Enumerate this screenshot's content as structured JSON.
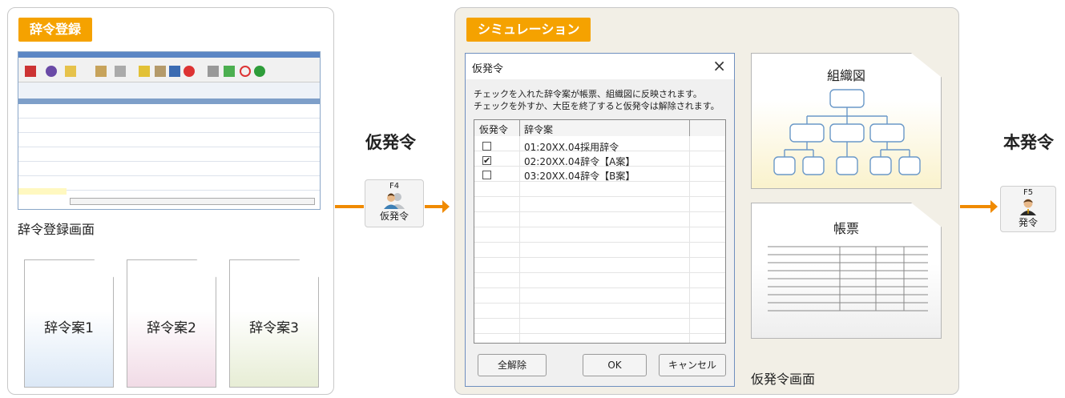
{
  "left": {
    "tag": "辞令登録",
    "screen_caption": "辞令登録画面",
    "drafts": [
      "辞令案1",
      "辞令案2",
      "辞令案3"
    ]
  },
  "middle": {
    "action_label": "仮発令",
    "fkey": {
      "key": "F4",
      "label": "仮発令"
    }
  },
  "simulation": {
    "tag": "シミュレーション",
    "dialog": {
      "title": "仮発令",
      "close": "×",
      "message_line1": "チェックを入れた辞令案が帳票、組織図に反映されます。",
      "message_line2": "チェックを外すか、大臣を終了すると仮発令は解除されます。",
      "col_check": "仮発令",
      "col_name": "辞令案",
      "rows": [
        {
          "checked": false,
          "name": "01:20XX.04採用辞令"
        },
        {
          "checked": true,
          "name": "02:20XX.04辞令【A案】"
        },
        {
          "checked": false,
          "name": "03:20XX.04辞令【B案】"
        }
      ],
      "btn_clear_all": "全解除",
      "btn_ok": "OK",
      "btn_cancel": "キャンセル"
    },
    "org_chart_title": "組織図",
    "report_title": "帳票",
    "screen_caption": "仮発令画面"
  },
  "right": {
    "action_label": "本発令",
    "fkey": {
      "key": "F5",
      "label": "発令"
    }
  },
  "colors": {
    "accent": "#f5a200",
    "arrow": "#f08a00",
    "sim_bg": "#f2efe6"
  }
}
